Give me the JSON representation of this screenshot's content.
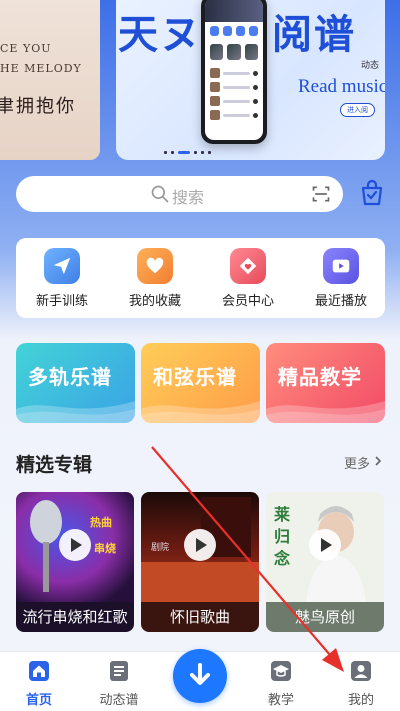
{
  "banner": {
    "prev_line1": "CE YOU",
    "prev_line2": "HE MELODY",
    "prev_line3": "聿拥抱你",
    "title_left": "天ヌ",
    "title_right": "阅谱",
    "subtitle": "Read music",
    "tag": "动态",
    "enter": "进入阅",
    "slide_count": 6,
    "active_slide": 2
  },
  "search": {
    "placeholder": "搜索"
  },
  "quick_actions": [
    {
      "label": "新手训练",
      "icon": "paper-plane-icon",
      "color": "#4a8ff0"
    },
    {
      "label": "我的收藏",
      "icon": "heart-icon",
      "color": "#f08a3c"
    },
    {
      "label": "会员中心",
      "icon": "diamond-heart-icon",
      "color": "#ef5d6a"
    },
    {
      "label": "最近播放",
      "icon": "play-screen-icon",
      "color": "#6a62e8"
    }
  ],
  "categories": [
    {
      "label": "多轨乐谱",
      "color_from": "#3fcdd3",
      "color_to": "#3aa6e4"
    },
    {
      "label": "和弦乐谱",
      "color_from": "#ffcb55",
      "color_to": "#ff9f4a"
    },
    {
      "label": "精品教学",
      "color_from": "#ff8b7c",
      "color_to": "#f24d66"
    }
  ],
  "section": {
    "title": "精选专辑",
    "more": "更多"
  },
  "albums": [
    {
      "label": "流行串烧和红歌",
      "art_text": "热曲串烧"
    },
    {
      "label": "怀旧歌曲",
      "art_text": "剧院"
    },
    {
      "label": "魅鸟原创",
      "art_text": "莱归念"
    }
  ],
  "tabs": [
    {
      "label": "首页",
      "active": true
    },
    {
      "label": "动态谱",
      "active": false
    },
    {
      "label": "教学",
      "active": false
    },
    {
      "label": "我的",
      "active": false
    }
  ],
  "colors": {
    "accent": "#2b63e8",
    "annotation": "#e8302a"
  }
}
